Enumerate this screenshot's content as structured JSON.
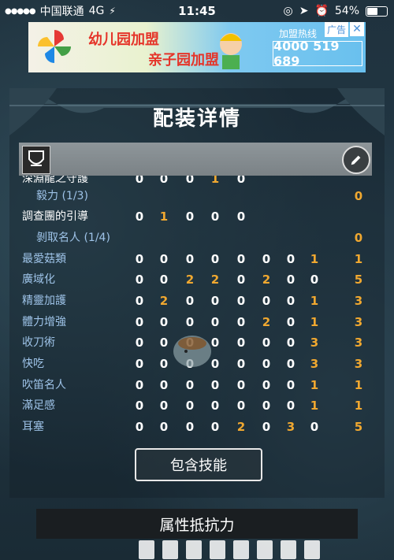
{
  "status_bar": {
    "carrier": "中国联通",
    "network": "4G",
    "time": "11:45",
    "battery": "54%"
  },
  "ad": {
    "line1": "幼儿园加盟",
    "line2": "亲子园加盟",
    "hotline_label": "加盟热线",
    "phone": "4000 519 689",
    "tag": "广告",
    "close": "✕"
  },
  "panel": {
    "title": "配装详情",
    "contain_skills_button": "包含技能",
    "resistance_header": "属性抵抗力"
  },
  "skills": [
    {
      "name": "深淵龍之守護",
      "style": "white",
      "values": [
        "0",
        "0",
        "0",
        "1",
        "0",
        "",
        "",
        ""
      ],
      "orange": [
        3
      ]
    },
    {
      "name": "毅力 (1/3)",
      "style": "indent",
      "values": [
        "",
        "",
        "",
        "",
        "",
        "",
        "",
        ""
      ],
      "total": "0"
    },
    {
      "name": "調查團的引導",
      "style": "white",
      "values": [
        "0",
        "1",
        "0",
        "0",
        "0",
        "",
        "",
        ""
      ],
      "orange": [
        1
      ]
    },
    {
      "name": "剝取名人 (1/4)",
      "style": "indent",
      "values": [
        "",
        "",
        "",
        "",
        "",
        "",
        "",
        ""
      ],
      "total": "0"
    },
    {
      "name": "最愛菇類",
      "style": "blue",
      "values": [
        "0",
        "0",
        "0",
        "0",
        "0",
        "0",
        "0",
        "1"
      ],
      "total": "1",
      "orange": [
        7
      ]
    },
    {
      "name": "廣域化",
      "style": "blue",
      "values": [
        "0",
        "0",
        "2",
        "2",
        "0",
        "2",
        "0",
        "0"
      ],
      "total": "5",
      "orange": [
        2,
        3,
        5
      ]
    },
    {
      "name": "精靈加護",
      "style": "blue",
      "values": [
        "0",
        "2",
        "0",
        "0",
        "0",
        "0",
        "0",
        "1"
      ],
      "total": "3",
      "orange": [
        1,
        7
      ]
    },
    {
      "name": "體力增強",
      "style": "blue",
      "values": [
        "0",
        "0",
        "0",
        "0",
        "0",
        "2",
        "0",
        "1"
      ],
      "total": "3",
      "orange": [
        5,
        7
      ]
    },
    {
      "name": "收刀術",
      "style": "blue",
      "values": [
        "0",
        "0",
        "0",
        "0",
        "0",
        "0",
        "0",
        "3"
      ],
      "total": "3",
      "orange": [
        7
      ]
    },
    {
      "name": "快吃",
      "style": "blue",
      "values": [
        "0",
        "0",
        "0",
        "0",
        "0",
        "0",
        "0",
        "3"
      ],
      "total": "3",
      "orange": [
        7
      ]
    },
    {
      "name": "吹笛名人",
      "style": "blue",
      "values": [
        "0",
        "0",
        "0",
        "0",
        "0",
        "0",
        "0",
        "1"
      ],
      "total": "1",
      "orange": [
        7
      ]
    },
    {
      "name": "滿足感",
      "style": "blue",
      "values": [
        "0",
        "0",
        "0",
        "0",
        "0",
        "0",
        "0",
        "1"
      ],
      "total": "1",
      "orange": [
        7
      ]
    },
    {
      "name": "耳塞",
      "style": "blue",
      "values": [
        "0",
        "0",
        "0",
        "0",
        "2",
        "0",
        "3",
        "0"
      ],
      "total": "5",
      "orange": [
        4,
        6
      ]
    }
  ]
}
